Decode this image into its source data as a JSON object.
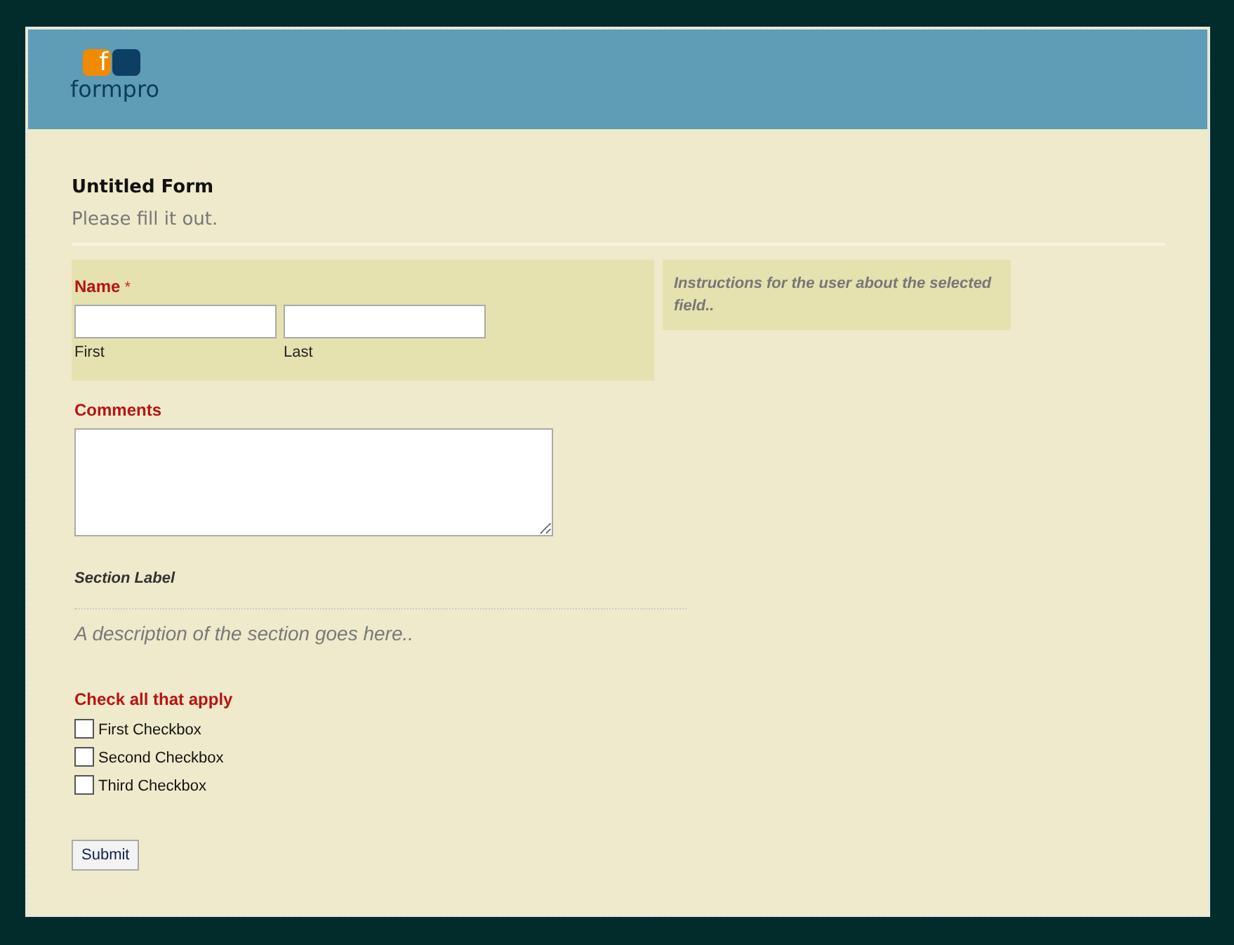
{
  "logo": {
    "mark": "f",
    "text": "formpro"
  },
  "form": {
    "title": "Untitled Form",
    "description": "Please fill it out."
  },
  "fields": [
    {
      "kind": "name",
      "label": "Name",
      "required_mark": "*",
      "selected": true,
      "parts": [
        {
          "sublabel": "First"
        },
        {
          "sublabel": "Last"
        }
      ]
    },
    {
      "kind": "textarea",
      "label": "Comments",
      "selected": false
    },
    {
      "kind": "section",
      "label": "Section Label",
      "description": "A description of the section goes here.."
    },
    {
      "kind": "checkboxes",
      "label": "Check all that apply",
      "selected": false,
      "options": [
        {
          "label": "First Checkbox",
          "checked": false
        },
        {
          "label": "Second Checkbox",
          "checked": false
        },
        {
          "label": "Third Checkbox",
          "checked": false
        }
      ]
    }
  ],
  "instructions": "Instructions for the user about the selected field..",
  "submit": "Submit"
}
